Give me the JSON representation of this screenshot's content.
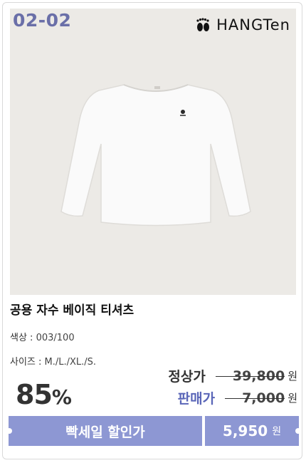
{
  "product": {
    "code": "02-02",
    "brand": "HANGTen",
    "name": "공용 자수 베이직 티셔츠",
    "color_label": "색상 : ",
    "color_value": "003/100",
    "size_label": "사이즈 : ",
    "size_value": "M./L./XL./S.",
    "discount": "85",
    "discount_unit": "%",
    "regular_label": "정상가",
    "regular_price": "39,800",
    "sale_label": "판매가",
    "sale_price": "7,000",
    "won": "원",
    "banner_text": "빡세일 할인가",
    "final_price": "5,950",
    "final_won": "원"
  },
  "colors": {
    "accent": "#8d97d3",
    "code": "#6a6fa8",
    "sale_label": "#5a66b8",
    "photo_bg": "#eceae6"
  }
}
